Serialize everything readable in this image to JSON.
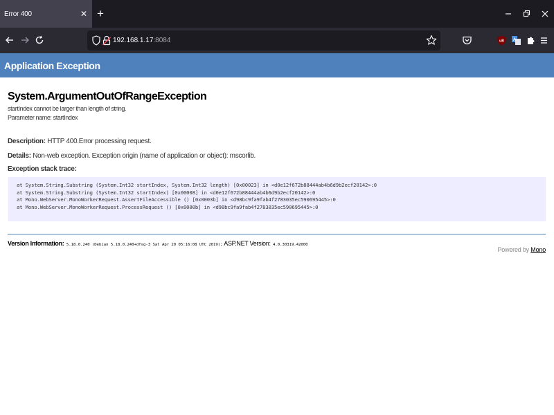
{
  "browser": {
    "tab": {
      "title": "Error 400"
    },
    "url": {
      "host": "192.168.1.17",
      "port": ":8084"
    },
    "icons": [
      "tab-close-icon",
      "new-tab-icon",
      "minimize-icon",
      "restore-icon",
      "close-window-icon",
      "back-icon",
      "forward-icon",
      "reload-icon",
      "shield-icon",
      "insecure-lock-icon",
      "bookmark-star-icon",
      "pocket-icon",
      "ublock-icon",
      "translate-icon",
      "extensions-icon",
      "menu-icon"
    ]
  },
  "page": {
    "header": "Application Exception",
    "exception": {
      "type": "System.ArgumentOutOfRangeException",
      "message_line1": "startIndex cannot be larger than length of string.",
      "message_line2": "Parameter name: startIndex"
    },
    "description": {
      "label": "Description:",
      "value": " HTTP 400.Error processing request."
    },
    "details": {
      "label": "Details:",
      "value": " Non-web exception. Exception origin (name of application or object): mscorlib."
    },
    "stack_trace_label": "Exception stack trace:",
    "stack_trace": [
      "at System.String.Substring (System.Int32 startIndex, System.Int32 length) [0x00023] in <d0e12f672b88444ab4b6d9b2ecf20142>:0",
      "at System.String.Substring (System.Int32 startIndex) [0x00008] in <d0e12f672b88444ab4b6d9b2ecf20142>:0",
      "at Mono.WebServer.MonoWorkerRequest.AssertFileAccessible () [0x0003b] in <d98bc9fa9fab4f2783035ec590695445>:0",
      "at Mono.WebServer.MonoWorkerRequest.ProcessRequest () [0x0000b] in <d98bc9fa9fab4f2783035ec590695445>:0"
    ],
    "version": {
      "label": "Version Information:",
      "mono": " 5.18.0.240 (Debian 5.18.0.240+dfsg-3 Sat Apr 20 05:16:08 UTC 2019);",
      "aspnet_label": " ASP.NET Version:",
      "aspnet": " 4.0.30319.42000"
    },
    "powered_by": {
      "text": "Powered by ",
      "link": "Mono"
    }
  },
  "colors": {
    "header_bg": "#4f81bd",
    "stack_bg": "#ededff",
    "tabbar_bg": "#1c1b22",
    "toolbar_bg": "#2b2a33",
    "ublock_red": "#800000"
  }
}
